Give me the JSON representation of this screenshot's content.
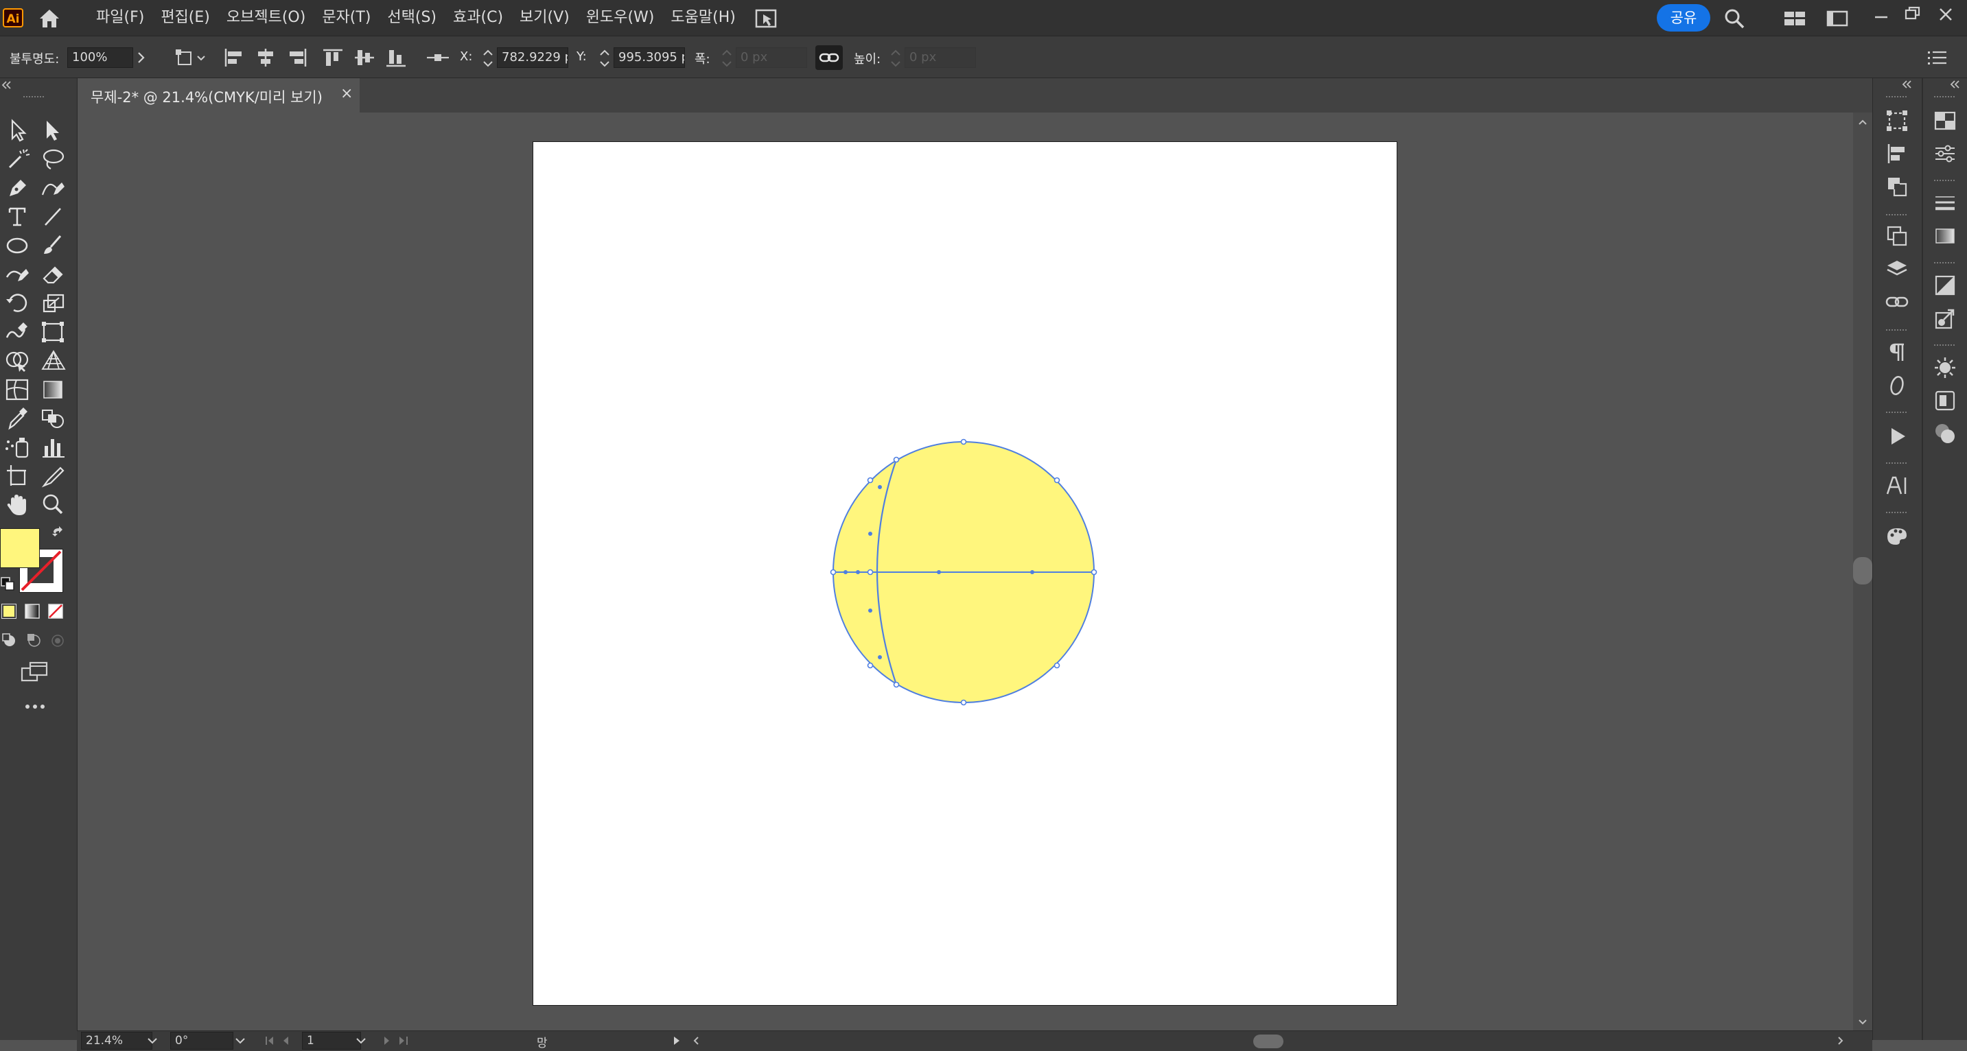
{
  "app": {
    "logo_text": "Ai",
    "menu": [
      "파일(F)",
      "편집(E)",
      "오브젝트(O)",
      "문자(T)",
      "선택(S)",
      "효과(C)",
      "보기(V)",
      "윈도우(W)",
      "도움말(H)"
    ],
    "share_label": "공유"
  },
  "control_bar": {
    "opacity_label": "불투명도:",
    "opacity_value": "100%",
    "x_label": "X:",
    "x_value": "782.9229 p",
    "y_label": "Y:",
    "y_value": "995.3095 p",
    "width_label": "폭:",
    "width_value": "0 px",
    "height_label": "높이:",
    "height_value": "0 px"
  },
  "document": {
    "tab_title": "무제-2* @ 21.4%(CMYK/미리 보기)",
    "close_glyph": "×"
  },
  "colors": {
    "fill": "#fff67d",
    "selection": "#4f7fe0",
    "accent": "#1473e6"
  },
  "status_bar": {
    "zoom": "21.4%",
    "rotation": "0°",
    "artboard_number": "1",
    "status_text": "망"
  }
}
